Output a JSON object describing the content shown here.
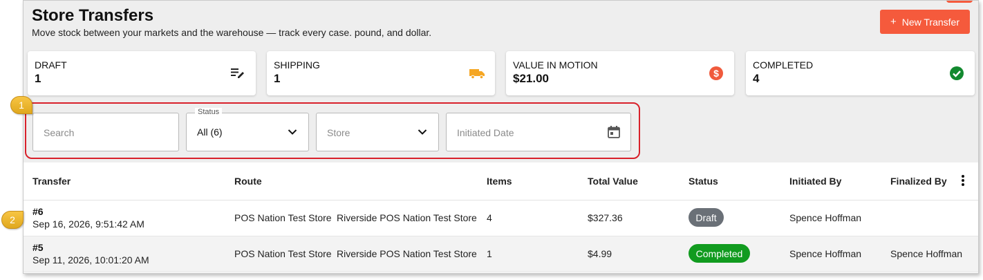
{
  "header": {
    "title": "Store Transfers",
    "subtitle": "Move stock between your markets and the warehouse — track every case. pound, and dollar.",
    "new_button": {
      "plus": "+",
      "label": "New Transfer"
    }
  },
  "stats": [
    {
      "label": "DRAFT",
      "value": "1",
      "icon": "edit-list-icon",
      "color": "#222222"
    },
    {
      "label": "SHIPPING",
      "value": "1",
      "icon": "truck-icon",
      "color": "#f5a623"
    },
    {
      "label": "VALUE IN MOTION",
      "value": "$21.00",
      "icon": "dollar-icon",
      "color": "#f05a3c"
    },
    {
      "label": "COMPLETED",
      "value": "4",
      "icon": "check-circle-icon",
      "color": "#12892f"
    }
  ],
  "filters": {
    "search_placeholder": "Search",
    "status_label": "Status",
    "status_value": "All (6)",
    "store_placeholder": "Store",
    "date_placeholder": "Initiated Date"
  },
  "table": {
    "columns": [
      "Transfer",
      "Route",
      "Items",
      "Total Value",
      "Status",
      "Initiated By",
      "Finalized By"
    ],
    "rows": [
      {
        "id": "#6",
        "date": "Sep 16, 2026, 9:51:42 AM",
        "route_from": "POS Nation Test Store",
        "route_to": "Riverside POS Nation Test Store",
        "items": "4",
        "total": "$327.36",
        "status": "Draft",
        "status_color": "#6a7077",
        "initiated_by": "Spence Hoffman",
        "finalized_by": ""
      },
      {
        "id": "#5",
        "date": "Sep 11, 2026, 10:01:20 AM",
        "route_from": "POS Nation Test Store",
        "route_to": "Riverside POS Nation Test Store",
        "items": "1",
        "total": "$4.99",
        "status": "Completed",
        "status_color": "#119b1f",
        "initiated_by": "Spence Hoffman",
        "finalized_by": "Spence Hoffman"
      }
    ]
  },
  "callouts": [
    "1",
    "2"
  ],
  "colors": {
    "accent": "#f55a3c",
    "highlight": "#d8202a",
    "callout": "#f2b930"
  }
}
